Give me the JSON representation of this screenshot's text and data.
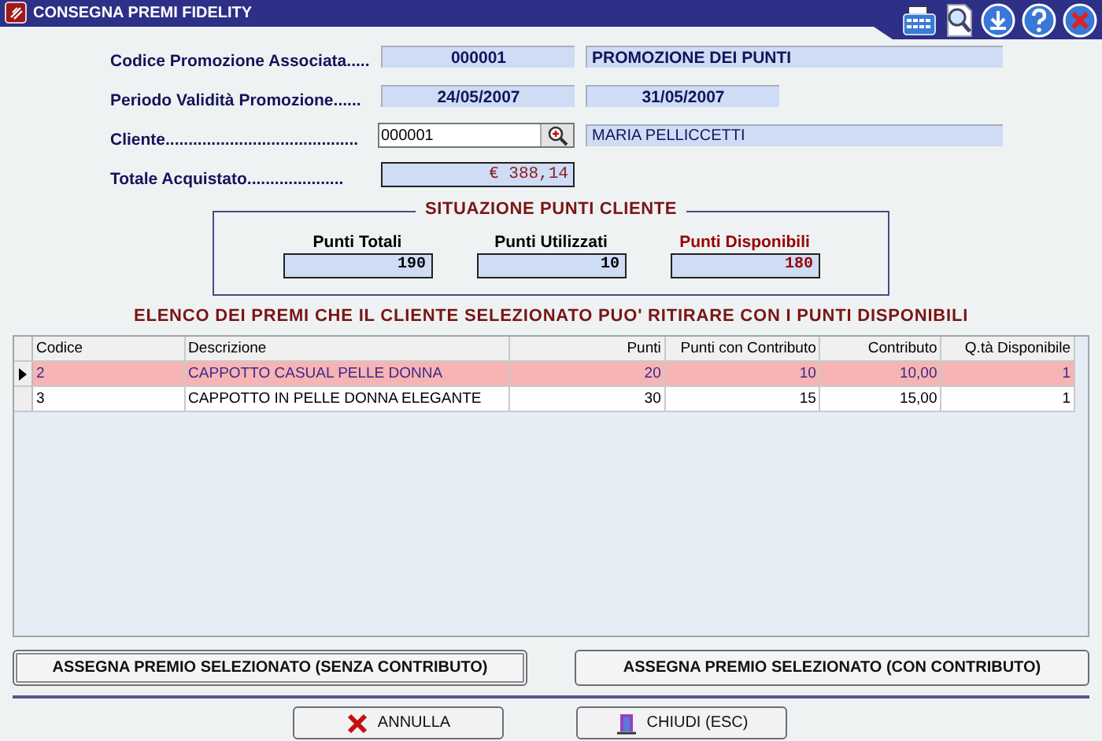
{
  "window": {
    "title": "CONSEGNA PREMI FIDELITY"
  },
  "promotion": {
    "label": "Codice Promozione Associata.....",
    "code": "000001",
    "name": "PROMOZIONE DEI PUNTI"
  },
  "period": {
    "label": "Periodo Validità Promozione......",
    "from": "24/05/2007",
    "to": "31/05/2007"
  },
  "customer": {
    "label": "Cliente..........................................",
    "code": "000001",
    "name": "MARIA PELLICCETTI"
  },
  "total": {
    "label": "Totale Acquistato.....................",
    "value": "€ 388,14"
  },
  "points_panel": {
    "title": "SITUAZIONE PUNTI CLIENTE",
    "items": [
      {
        "label": "Punti Totali",
        "value": "190",
        "color": "#000000"
      },
      {
        "label": "Punti Utilizzati",
        "value": "10",
        "color": "#000000"
      },
      {
        "label": "Punti Disponibili",
        "value": "180",
        "color": "#990000"
      }
    ]
  },
  "table": {
    "title": "ELENCO DEI PREMI CHE IL CLIENTE SELEZIONATO PUO' RITIRARE CON I PUNTI DISPONIBILI",
    "columns": [
      "Codice",
      "Descrizione",
      "Punti",
      "Punti con Contributo",
      "Contributo",
      "Q.tà Disponibile"
    ],
    "rows": [
      {
        "cells": [
          "2",
          "CAPPOTTO CASUAL PELLE DONNA",
          "20",
          "10",
          "10,00",
          "1"
        ],
        "selected": true
      },
      {
        "cells": [
          "3",
          "CAPPOTTO IN PELLE DONNA ELEGANTE",
          "30",
          "15",
          "15,00",
          "1"
        ],
        "selected": false
      }
    ]
  },
  "assign_buttons": [
    "ASSEGNA PREMIO SELEZIONATO (SENZA CONTRIBUTO)",
    "ASSEGNA PREMIO SELEZIONATO (CON CONTRIBUTO)"
  ],
  "footer_buttons": [
    {
      "label": "ANNULLA",
      "kind": "cancel"
    },
    {
      "label": "CHIUDI (ESC)",
      "kind": "close"
    }
  ]
}
